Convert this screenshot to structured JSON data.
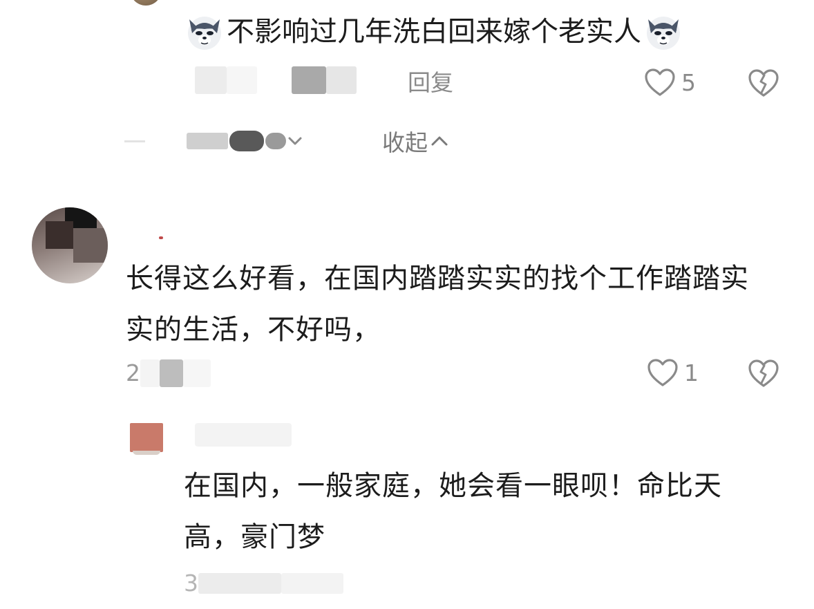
{
  "reply_top": {
    "text": "不影响过几年洗白回来嫁个老实人",
    "emoji_left": "wolf-emoji",
    "emoji_right": "wolf-emoji",
    "reply_label": "回复",
    "like_count": "5"
  },
  "thread": {
    "collapse_label": "收起"
  },
  "main_comment": {
    "text": "长得这么好看，在国内踏踏实实的找个工作踏踏实实的生活，不好吗，",
    "date_prefix": "2",
    "like_count": "1"
  },
  "reply_second": {
    "text": "在国内，一般家庭，她会看一眼呗！命比天高，豪门梦",
    "date_prefix": "3"
  },
  "icons": {
    "like": "heart-outline-icon",
    "dislike": "broken-heart-icon",
    "collapse": "chevron-up-icon",
    "expand": "chevron-down-icon"
  },
  "colors": {
    "text_primary": "#1c1c1c",
    "text_secondary": "#8a8a8a",
    "background": "#ffffff"
  }
}
